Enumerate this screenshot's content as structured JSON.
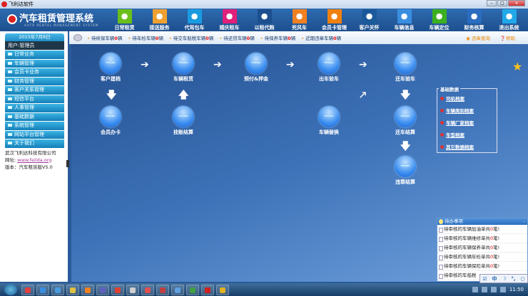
{
  "window": {
    "title": "飞利达软件",
    "min": "–",
    "max": "□",
    "close": "x"
  },
  "brand": {
    "title": "汽车租赁管理系统",
    "subtitle": "AUTO RENTAL MANAGEMENT SYSTEM"
  },
  "nav": [
    {
      "label": "日常租赁",
      "icon": "chat-icon",
      "color": "#6cbf1a"
    },
    {
      "label": "接送服务",
      "icon": "card-icon",
      "color": "#f0a030"
    },
    {
      "label": "代驾包车",
      "icon": "skype-icon",
      "color": "#1a9be0"
    },
    {
      "label": "婚庆租车",
      "icon": "person-icon",
      "color": "#e0207a"
    },
    {
      "label": "以租代购",
      "icon": "building-icon",
      "color": "#1d4f8e"
    },
    {
      "label": "兜风车",
      "icon": "car-icon",
      "color": "#f08020"
    },
    {
      "label": "会员卡管理",
      "icon": "rss-icon",
      "color": "#f08010"
    },
    {
      "label": "客户关怀",
      "icon": "drupal-icon",
      "color": "#1a5a9a"
    },
    {
      "label": "车辆信息",
      "icon": "gear-icon",
      "color": "#3a8ee0"
    },
    {
      "label": "车辆定位",
      "icon": "xbox-icon",
      "color": "#3cb020"
    },
    {
      "label": "财务核算",
      "icon": "grid-icon",
      "color": "#2a6cc0"
    },
    {
      "label": "退出系统",
      "icon": "twitter-icon",
      "color": "#20a8e8"
    }
  ],
  "notices": [
    {
      "text": "待续保车辆",
      "count": "0",
      "unit": "辆"
    },
    {
      "text": "待年检车辆",
      "count": "0",
      "unit": "辆"
    },
    {
      "text": "待交车船税车辆",
      "count": "0",
      "unit": "辆"
    },
    {
      "text": "待还贷车辆",
      "count": "0",
      "unit": "辆"
    },
    {
      "text": "待保养车辆",
      "count": "0",
      "unit": "辆"
    },
    {
      "text": "近期违章车辆",
      "count": "0",
      "unit": "辆"
    }
  ],
  "notice_links": {
    "violation": "违章查询",
    "help": "帮助"
  },
  "sidebar": {
    "date": "2015年7月8日",
    "user": "用户:管理员",
    "menu": [
      "日常业务",
      "车辆管理",
      "会员卡业务",
      "财务管理",
      "客户关系管理",
      "短信平台",
      "人事管理",
      "基础数据",
      "系统管理",
      "网站平台管理",
      "关于我们"
    ],
    "company": "武汉飞利达科技有限公司",
    "site_label": "网址:",
    "site": "www.feilda.org",
    "version": "版本：汽车租赁版V5.0"
  },
  "flow": {
    "ball_text": "FEILIDA",
    "nodes": [
      "客户建档",
      "车辆租赁",
      "预付&押金",
      "出车验车",
      "还车验车",
      "会员办卡",
      "挂账结算",
      "车辆替换",
      "还车结算",
      "违章结算"
    ]
  },
  "basic": {
    "title": "基础数据",
    "links": [
      "司机档案",
      "车辆类别档案",
      "车辆厂家档案",
      "车型档案",
      "其它数据档案"
    ]
  },
  "todo": {
    "title": "待办事项",
    "min": "-",
    "items": [
      {
        "text": "待审核的车辆加油单共",
        "count": "0",
        "unit": "笔!"
      },
      {
        "text": "待审核的车辆维修单共",
        "count": "0",
        "unit": "笔!"
      },
      {
        "text": "待审核的车辆保养单共",
        "count": "0",
        "unit": "笔!"
      },
      {
        "text": "待审核的车辆年检单共",
        "count": "0",
        "unit": "笔!"
      },
      {
        "text": "待审核的车辆保险单共",
        "count": "0",
        "unit": "笔!"
      },
      {
        "text": "待审核的车船税",
        "count": "",
        "unit": ""
      }
    ]
  },
  "ime": {
    "lang": "中"
  },
  "taskbar": {
    "time": "11:50",
    "apps": [
      "#e04040",
      "#3a8ee0",
      "#4a9ae0",
      "#e0c040",
      "#f08020",
      "#6060c0",
      "#e04030",
      "#d0d0d0",
      "#e05050",
      "#c04040",
      "#60a0e0",
      "#40a040",
      "#d02020",
      "#e0b020"
    ]
  }
}
